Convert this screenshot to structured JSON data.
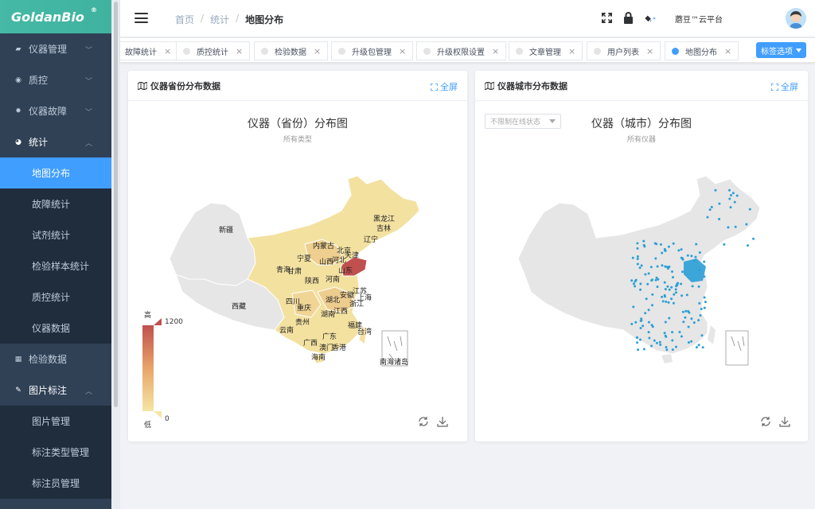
{
  "app": {
    "logo": "GoldanBio",
    "logo_mark": "®"
  },
  "sidebar": {
    "items": [
      {
        "label": "仪器管理",
        "icon": "instrument-icon"
      },
      {
        "label": "质控",
        "icon": "target-icon"
      },
      {
        "label": "仪器故障",
        "icon": "bug-icon"
      },
      {
        "label": "统计",
        "icon": "pie-icon"
      }
    ],
    "stats_children": [
      "地图分布",
      "故障统计",
      "试剂统计",
      "检验样本统计",
      "质控统计",
      "仪器数据"
    ],
    "after_items": [
      {
        "label": "检验数据",
        "icon": "table-icon"
      },
      {
        "label": "图片标注",
        "icon": "edit-icon"
      }
    ],
    "image_children": [
      "图片管理",
      "标注类型管理",
      "标注员管理"
    ]
  },
  "header": {
    "breadcrumb": [
      "首页",
      "统计",
      "地图分布"
    ],
    "user": "蘑豆™云平台"
  },
  "tags": {
    "items": [
      "故障统计",
      "质控统计",
      "检验数据",
      "升级包管理",
      "升级权限设置",
      "文章管理",
      "用户列表",
      "地图分布"
    ],
    "options_label": "标签选项"
  },
  "card_left": {
    "title": "仪器省份分布数据",
    "fullscreen": "全屏",
    "chart_title": "仪器（省份）分布图",
    "chart_subtitle": "所有类型",
    "legend": {
      "high": "高",
      "low": "低",
      "max": "1200",
      "min": "0"
    },
    "colors": {
      "high": "#c0504d",
      "mid": "#e8a46a",
      "low": "#f5e6a4",
      "none": "#e6e6e6"
    },
    "provinces": [
      "新疆",
      "西藏",
      "青海",
      "甘肃",
      "宁夏",
      "内蒙古",
      "黑龙江",
      "吉林",
      "辽宁",
      "北京",
      "天津",
      "河北",
      "山西",
      "陕西",
      "山东",
      "河南",
      "四川",
      "重庆",
      "湖北",
      "安徽",
      "江苏",
      "上海",
      "浙江",
      "湖南",
      "江西",
      "贵州",
      "云南",
      "广西",
      "广东",
      "福建",
      "台湾",
      "香港",
      "澳门",
      "海南",
      "南海诸岛"
    ]
  },
  "card_right": {
    "title": "仪器城市分布数据",
    "fullscreen": "全屏",
    "chart_title": "仪器（城市）分布图",
    "chart_subtitle": "所有仪器",
    "select_value": "不限制在线状态",
    "point_color": "#2a9fd6"
  }
}
